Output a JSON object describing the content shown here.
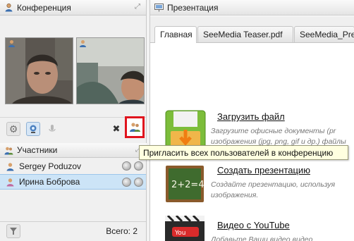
{
  "left_panel": {
    "title": "Конференция",
    "participants": {
      "title": "Участники",
      "items": [
        {
          "name": "Sergey Poduzov",
          "selected": false
        },
        {
          "name": "Ирина Боброва",
          "selected": true
        }
      ],
      "total_label": "Всего: 2"
    }
  },
  "right_panel": {
    "title": "Презентация",
    "tabs": [
      {
        "label": "Главная",
        "active": true
      },
      {
        "label": "SeeMedia Teaser.pdf",
        "active": false
      },
      {
        "label": "SeeMedia_Pres",
        "active": false
      }
    ],
    "features": [
      {
        "title": "Загрузить файл",
        "desc": "Загрузите офисные документы (pr изображения (jpg, png, gif и др.) файлы"
      },
      {
        "title": "Создать презентацию",
        "desc": "Создайте презентацию, используя изображения."
      },
      {
        "title": "Видео с YouTube",
        "desc": "Добавьте Ваши видео видео"
      }
    ]
  },
  "tooltip": "Пригласить всех пользователей в конференцию",
  "colors": {
    "selected_row": "#cce4f7",
    "highlight_box": "#e0141e",
    "tooltip_bg": "#ffffe0"
  }
}
